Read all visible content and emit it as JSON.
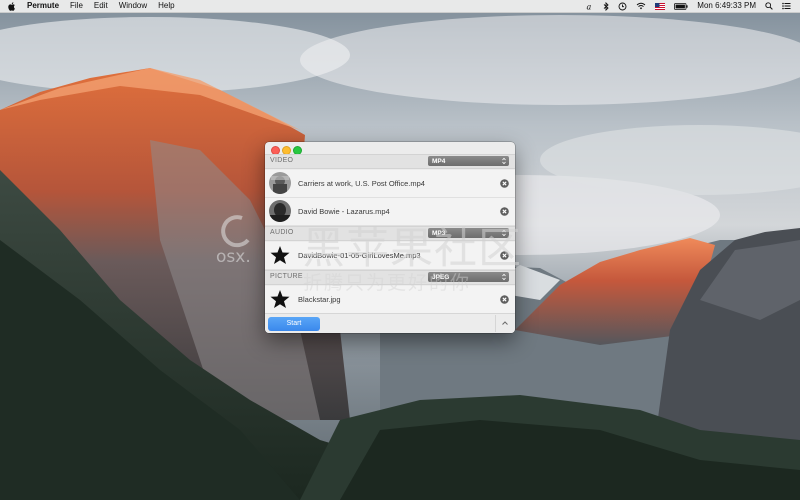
{
  "menubar": {
    "app_name": "Permute",
    "menus": [
      "File",
      "Edit",
      "Window",
      "Help"
    ],
    "clock": "Mon 6:49:33 PM"
  },
  "window": {
    "sections": [
      {
        "label": "VIDEO",
        "format": "MP4",
        "files": [
          {
            "name": "Carriers at work, U.S. Post Office.mp4",
            "thumbnail": "video-thumbnail"
          },
          {
            "name": "David Bowie - Lazarus.mp4",
            "thumbnail": "video-thumbnail"
          }
        ]
      },
      {
        "label": "AUDIO",
        "format": "MP3",
        "files": [
          {
            "name": "DavidBowie-01-05-GirlLovesMe.mp3",
            "thumbnail": "star-icon"
          }
        ]
      },
      {
        "label": "PICTURE",
        "format": "JPEG",
        "files": [
          {
            "name": "Blackstar.jpg",
            "thumbnail": "star-icon"
          }
        ]
      }
    ],
    "start_label": "Start"
  },
  "watermark": {
    "main": "黑苹果社区",
    "sub": "折腾只为更好的你",
    "site": "osx."
  },
  "colors": {
    "start_button": "#3a88ec",
    "select_background": "#7a7a7a",
    "window_background": "#ececec"
  }
}
